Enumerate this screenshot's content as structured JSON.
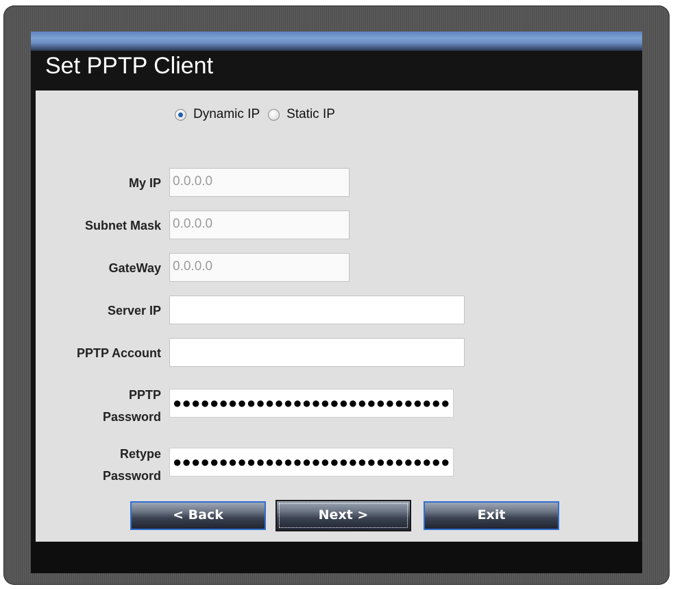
{
  "dialog": {
    "title": "Set PPTP Client"
  },
  "ip_mode": {
    "dynamic_label": "Dynamic IP",
    "static_label": "Static IP",
    "selected": "Dynamic IP"
  },
  "fields": {
    "my_ip": {
      "label": "My IP",
      "value": "0.0.0.0"
    },
    "subnet_mask": {
      "label": "Subnet Mask",
      "value": "0.0.0.0"
    },
    "gateway": {
      "label": "GateWay",
      "value": "0.0.0.0"
    },
    "server_ip": {
      "label": "Server IP",
      "value": ""
    },
    "pptp_account": {
      "label": "PPTP Account",
      "value": ""
    },
    "pptp_password": {
      "label_line1": "PPTP",
      "label_line2": "Password",
      "masked": "●●●●●●●●●●●●●●●●●●●●●●●●●●●●●●"
    },
    "retype_password": {
      "label_line1": "Retype",
      "label_line2": "Password",
      "masked": "●●●●●●●●●●●●●●●●●●●●●●●●●●●●●●"
    }
  },
  "buttons": {
    "back": "< Back",
    "next": "Next >",
    "exit": "Exit"
  },
  "colors": {
    "title_gradient": "#7ea1d3",
    "content_bg": "#e0e0e0",
    "button_border": "#2f6fd1",
    "radio_dot": "#1f5fb0"
  }
}
